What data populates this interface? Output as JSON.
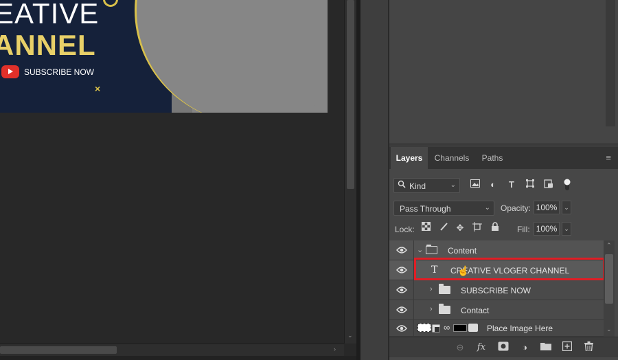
{
  "canvas": {
    "headline_line1": "EATIVE",
    "headline_line2": "ANNEL",
    "subscribe_text": "SUBSCRIBE NOW",
    "x_mark": "×"
  },
  "layers_panel": {
    "tabs": [
      {
        "label": "Layers",
        "active": true
      },
      {
        "label": "Channels",
        "active": false
      },
      {
        "label": "Paths",
        "active": false
      }
    ],
    "menu_icon": "≡",
    "filter": {
      "kind_label": "Kind",
      "icons": [
        "image-filter-icon",
        "adjustment-filter-icon",
        "type-filter-icon",
        "shape-filter-icon",
        "smart-object-filter-icon",
        "filter-toggle-icon"
      ]
    },
    "blend_mode": "Pass Through",
    "opacity_label": "Opacity:",
    "opacity_value": "100%",
    "lock_label": "Lock:",
    "fill_label": "Fill:",
    "fill_value": "100%",
    "layers": [
      {
        "name": "Content",
        "type": "group",
        "expanded": true,
        "indent": 0
      },
      {
        "name": "CREATIVE VLOGER CHANNEL",
        "type": "text",
        "selected": true,
        "indent": 1
      },
      {
        "name": "SUBSCRIBE NOW",
        "type": "group",
        "expanded": false,
        "indent": 1
      },
      {
        "name": "Contact",
        "type": "group",
        "expanded": false,
        "indent": 1
      },
      {
        "name": "Place Image Here",
        "type": "smart-masked",
        "indent": 0
      }
    ],
    "bottom_icons": [
      "link-layers-icon",
      "fx-icon",
      "add-mask-icon",
      "adjustment-layer-icon",
      "new-group-icon",
      "new-layer-icon",
      "delete-layer-icon"
    ],
    "fx_label": "fx",
    "highlight_color": "#e01e25"
  }
}
